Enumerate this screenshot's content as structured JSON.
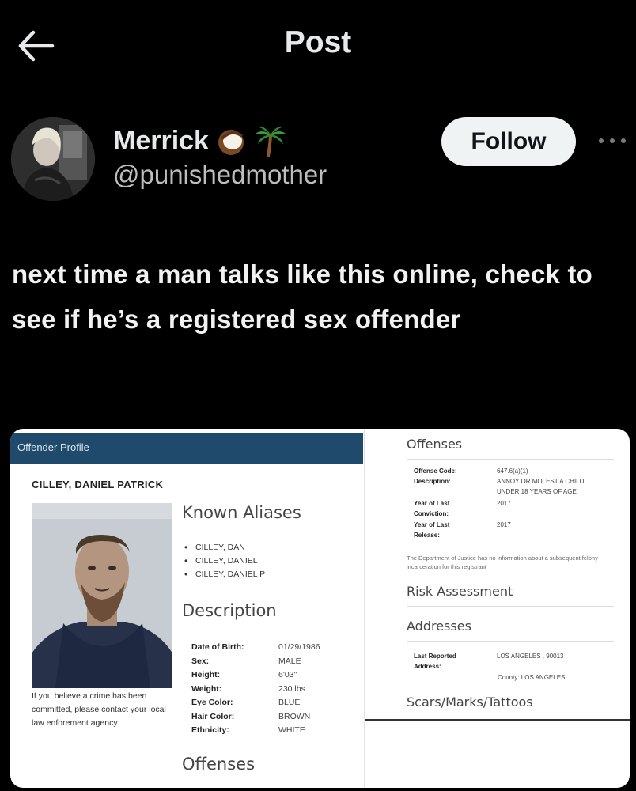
{
  "header": {
    "title": "Post",
    "back_icon": "arrow-left-icon"
  },
  "author": {
    "display_name": "Merrick",
    "handle": "@punishedmother",
    "name_emojis": [
      "coconut-icon",
      "palm-tree-icon"
    ],
    "follow_label": "Follow"
  },
  "tweet": {
    "text": "next time a man talks like this online, check to see if he’s a registered sex offender"
  },
  "profile": {
    "header": "Offender Profile",
    "name": "CILLEY, DANIEL PATRICK",
    "crime_note": "If you believe a crime has been committed, please contact your local law enforement agency.",
    "aliases_heading": "Known Aliases",
    "aliases": [
      "CILLEY, DAN",
      "CILLEY, DANIEL",
      "CILLEY, DANIEL P"
    ],
    "description_heading": "Description",
    "description": [
      {
        "label": "Date of Birth:",
        "value": "01/29/1986"
      },
      {
        "label": "Sex:",
        "value": "MALE"
      },
      {
        "label": "Height:",
        "value": "6'03\""
      },
      {
        "label": "Weight:",
        "value": "230 lbs"
      },
      {
        "label": "Eye Color:",
        "value": "BLUE"
      },
      {
        "label": "Hair Color:",
        "value": "BROWN"
      },
      {
        "label": "Ethnicity:",
        "value": "WHITE"
      }
    ],
    "offenses_heading_left": "Offenses"
  },
  "offenses": {
    "heading": "Offenses",
    "offense_code_label": "Offense Code:",
    "offense_code": "647.6(a)(1)",
    "description_label": "Description:",
    "description_line1": "ANNOY OR MOLEST A CHILD",
    "description_line2": "UNDER 18 YEARS OF AGE",
    "conviction_label_1": "Year of Last",
    "conviction_label_2": "Conviction:",
    "conviction_year": "2017",
    "release_label_1": "Year of Last",
    "release_label_2": "Release:",
    "release_year": "2017",
    "doj_note": "The Department of Justice has no information about a subsequent felony incarceration for this registrant"
  },
  "risk": {
    "heading": "Risk Assessment"
  },
  "addresses": {
    "heading": "Addresses",
    "label_1": "Last Reported",
    "label_2": "Address:",
    "value": "LOS ANGELES , 90013",
    "county": "County: LOS ANGELES"
  },
  "scars": {
    "heading": "Scars/Marks/Tattoos"
  },
  "colors": {
    "background": "#000000",
    "text": "#e7e9ea",
    "follow_button": "#eff3f4",
    "profile_header": "#1f4a6b"
  }
}
